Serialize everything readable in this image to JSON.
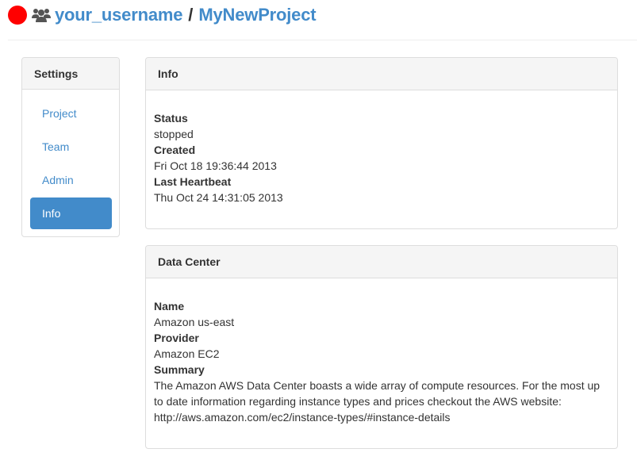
{
  "header": {
    "status_color": "#ff0000",
    "icon": "users-icon",
    "username": "your_username",
    "separator": "/",
    "project": "MyNewProject"
  },
  "sidebar": {
    "heading": "Settings",
    "items": [
      {
        "label": "Project",
        "active": false
      },
      {
        "label": "Team",
        "active": false
      },
      {
        "label": "Admin",
        "active": false
      },
      {
        "label": "Info",
        "active": true
      }
    ]
  },
  "info_panel": {
    "heading": "Info",
    "fields": [
      {
        "label": "Status",
        "value": "stopped"
      },
      {
        "label": "Created",
        "value": "Fri Oct 18 19:36:44 2013"
      },
      {
        "label": "Last Heartbeat",
        "value": "Thu Oct 24 14:31:05 2013"
      }
    ]
  },
  "datacenter_panel": {
    "heading": "Data Center",
    "fields": [
      {
        "label": "Name",
        "value": "Amazon us-east"
      },
      {
        "label": "Provider",
        "value": "Amazon EC2"
      },
      {
        "label": "Summary",
        "value": "The Amazon AWS Data Center boasts a wide array of compute resources. For the most up to date information regarding instance types and prices checkout the AWS website: http://aws.amazon.com/ec2/instance-types/#instance-details"
      }
    ]
  },
  "colors": {
    "link": "#428bca",
    "active_bg": "#428bca",
    "panel_heading_bg": "#f5f5f5",
    "border": "#dddddd"
  }
}
